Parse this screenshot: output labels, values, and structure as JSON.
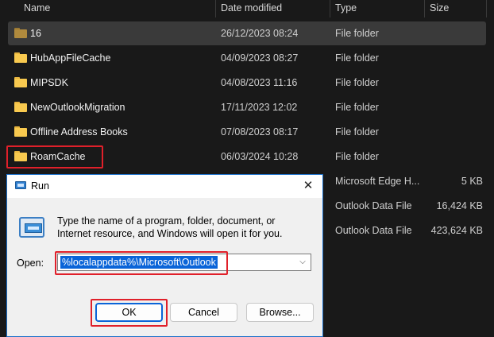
{
  "explorer": {
    "columns": {
      "name": "Name",
      "date": "Date modified",
      "type": "Type",
      "size": "Size"
    },
    "rows": [
      {
        "name": "16",
        "date": "26/12/2023 08:24",
        "type": "File folder",
        "size": ""
      },
      {
        "name": "HubAppFileCache",
        "date": "04/09/2023 08:27",
        "type": "File folder",
        "size": ""
      },
      {
        "name": "MIPSDK",
        "date": "04/08/2023 11:16",
        "type": "File folder",
        "size": ""
      },
      {
        "name": "NewOutlookMigration",
        "date": "17/11/2023 12:02",
        "type": "File folder",
        "size": ""
      },
      {
        "name": "Offline Address Books",
        "date": "07/08/2023 08:17",
        "type": "File folder",
        "size": ""
      },
      {
        "name": "RoamCache",
        "date": "06/03/2024 10:28",
        "type": "File folder",
        "size": ""
      },
      {
        "name": "",
        "date": "",
        "type": "Microsoft Edge H...",
        "size": "5 KB"
      },
      {
        "name": "",
        "date": "",
        "type": "Outlook Data File",
        "size": "16,424 KB"
      },
      {
        "name": "",
        "date": "",
        "type": "Outlook Data File",
        "size": "423,624 KB"
      }
    ]
  },
  "run_dialog": {
    "title": "Run",
    "description": "Type the name of a program, folder, document, or Internet resource, and Windows will open it for you.",
    "open_label": "Open:",
    "open_value": "%localappdata%\\Microsoft\\Outlook",
    "ok_label": "OK",
    "cancel_label": "Cancel",
    "browse_label": "Browse...",
    "close_glyph": "✕"
  },
  "colors": {
    "highlight": "#e0202a",
    "accent": "#0a64d8",
    "folder": "#f8c94f"
  }
}
